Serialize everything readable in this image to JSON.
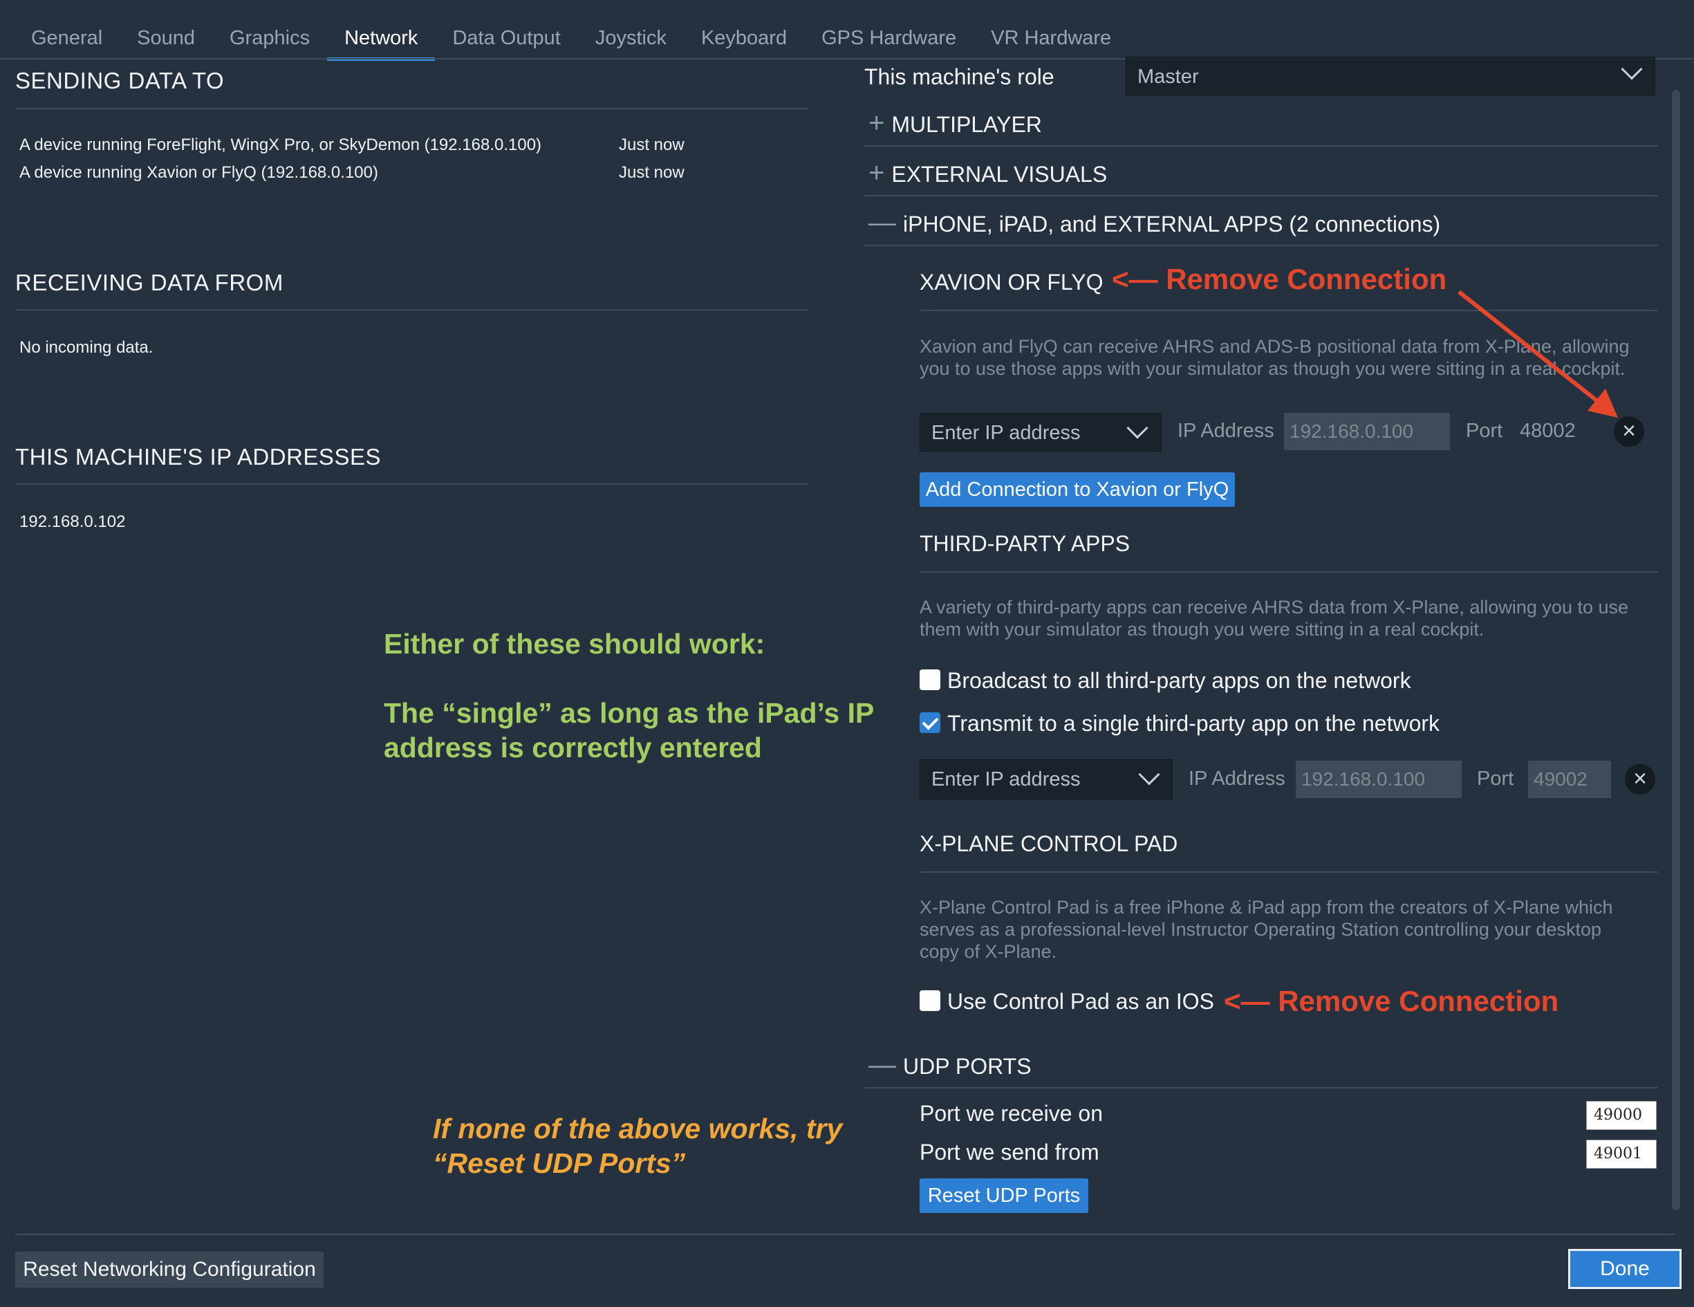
{
  "tabs": [
    "General",
    "Sound",
    "Graphics",
    "Network",
    "Data Output",
    "Joystick",
    "Keyboard",
    "GPS Hardware",
    "VR Hardware"
  ],
  "active_tab": "Network",
  "left": {
    "sending_title": "SENDING DATA TO",
    "sending_rows": [
      {
        "device": "A device running ForeFlight, WingX Pro, or SkyDemon (192.168.0.100)",
        "time": "Just now"
      },
      {
        "device": "A device running Xavion or FlyQ (192.168.0.100)",
        "time": "Just now"
      }
    ],
    "receiving_title": "RECEIVING DATA FROM",
    "receiving_text": "No incoming data.",
    "ip_title": "THIS MACHINE'S IP ADDRESSES",
    "ip_value": "192.168.0.102"
  },
  "right": {
    "role_label": "This machine's role",
    "role_value": "Master",
    "sections": {
      "multiplayer": "MULTIPLAYER",
      "external_visuals": "EXTERNAL VISUALS",
      "iphone": "iPHONE, iPAD, and EXTERNAL APPS (2 connections)",
      "udp": "UDP PORTS"
    },
    "xavion": {
      "title": "XAVION OR FLYQ",
      "desc_line1": "Xavion and FlyQ can receive AHRS and ADS-B positional data from X-Plane, allowing",
      "desc_line2": "you to use those apps with your simulator as though you were sitting in a real cockpit.",
      "dropdown": "Enter IP address",
      "ip_label": "IP Address",
      "ip_value": "192.168.0.100",
      "port_label": "Port",
      "port_value": "48002",
      "add_button": "Add Connection to Xavion or FlyQ"
    },
    "thirdparty": {
      "title": "THIRD-PARTY APPS",
      "desc_line1": "A variety of third-party apps can receive AHRS data from X-Plane, allowing you to use",
      "desc_line2": "them with your simulator as though you were sitting in a real cockpit.",
      "broadcast_label": "Broadcast to all third-party apps on the network",
      "broadcast_checked": false,
      "single_label": "Transmit to a single third-party app on the network",
      "single_checked": true,
      "dropdown": "Enter IP address",
      "ip_label": "IP Address",
      "ip_value": "192.168.0.100",
      "port_label": "Port",
      "port_value": "49002"
    },
    "controlpad": {
      "title": "X-PLANE CONTROL PAD",
      "desc_line1": "X-Plane Control Pad is a free iPhone & iPad app from the creators of X-Plane which",
      "desc_line2": "serves as a professional-level Instructor Operating Station controlling your desktop",
      "desc_line3": "copy of X-Plane.",
      "ios_label": "Use Control Pad as an IOS",
      "ios_checked": false
    },
    "udp": {
      "receive_label": "Port we receive on",
      "receive_value": "49000",
      "send_label": "Port we send from",
      "send_value": "49001",
      "reset_button": "Reset UDP Ports"
    }
  },
  "footer": {
    "reset_button": "Reset Networking Configuration",
    "done_button": "Done"
  },
  "annotations": {
    "remove1": "<— Remove Connection",
    "remove2": "<— Remove Connection",
    "green_line1": "Either of these should work:",
    "green_line2": "The “single” as long as the iPad’s IP",
    "green_line3": "address is correctly entered",
    "orange_line1": "If none of the above works, try",
    "orange_line2": "“Reset UDP Ports”"
  },
  "colors": {
    "background": "#263140",
    "accent": "#2d7fd4",
    "annotation_red": "#e4472b",
    "annotation_green": "#a3cf62",
    "annotation_orange": "#f1a73a"
  }
}
